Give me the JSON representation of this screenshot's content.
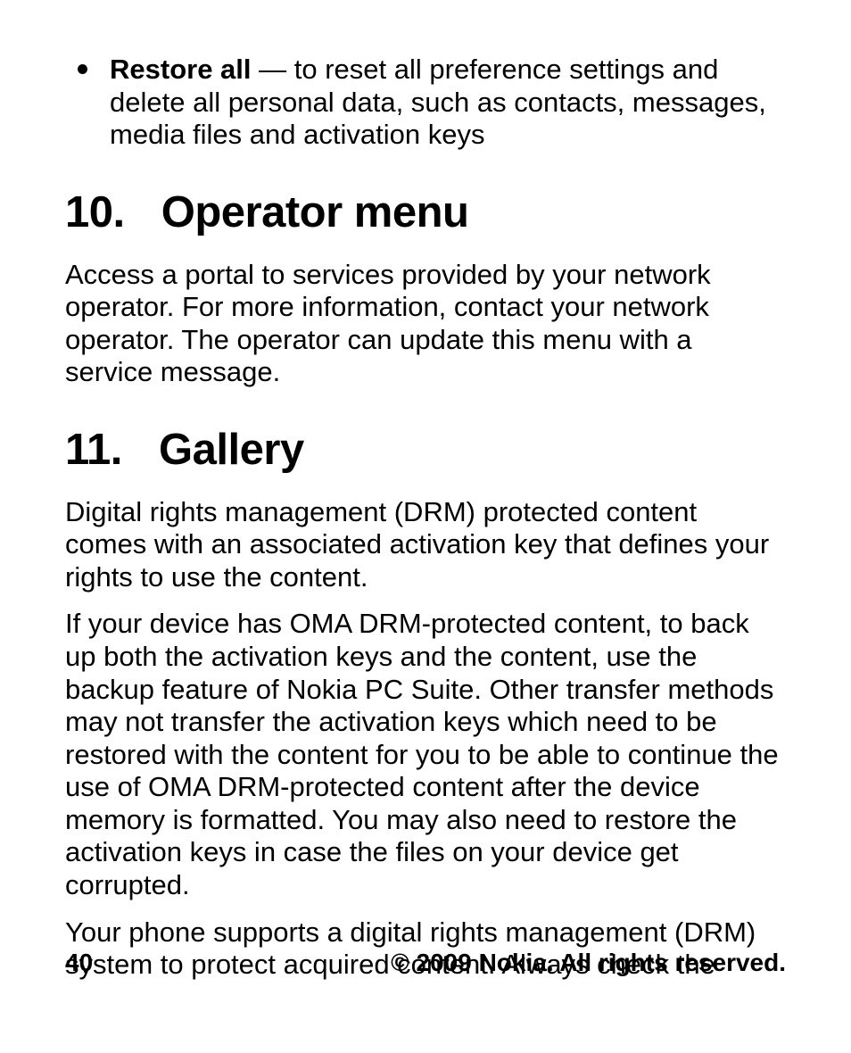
{
  "bullet": {
    "lead": "Restore all",
    "sep": "  —  ",
    "rest": "to reset all preference settings and delete all personal data, such as contacts, messages, media files and activation keys"
  },
  "section10": {
    "num": "10.",
    "title": "Operator menu",
    "p1": "Access a portal to services provided by your network operator. For more information, contact your network operator. The operator can update this menu with a service message."
  },
  "section11": {
    "num": "11.",
    "title": "Gallery",
    "p1": "Digital rights management (DRM) protected content comes with an associated activation key that defines your rights to use the content.",
    "p2": "If your device has OMA DRM-protected content, to back up both the activation keys and the content, use the backup feature of Nokia PC Suite. Other transfer methods may not transfer the activation keys which need to be restored with the content for you to be able to continue the use of OMA DRM-protected content after the device memory is formatted. You may also need to restore the activation keys in case the files on your device get corrupted.",
    "p3": "Your phone supports a digital rights management (DRM) system to protect acquired content. Always check the"
  },
  "footer": {
    "page": "40",
    "copyright": "© 2009 Nokia. All rights reserved."
  }
}
